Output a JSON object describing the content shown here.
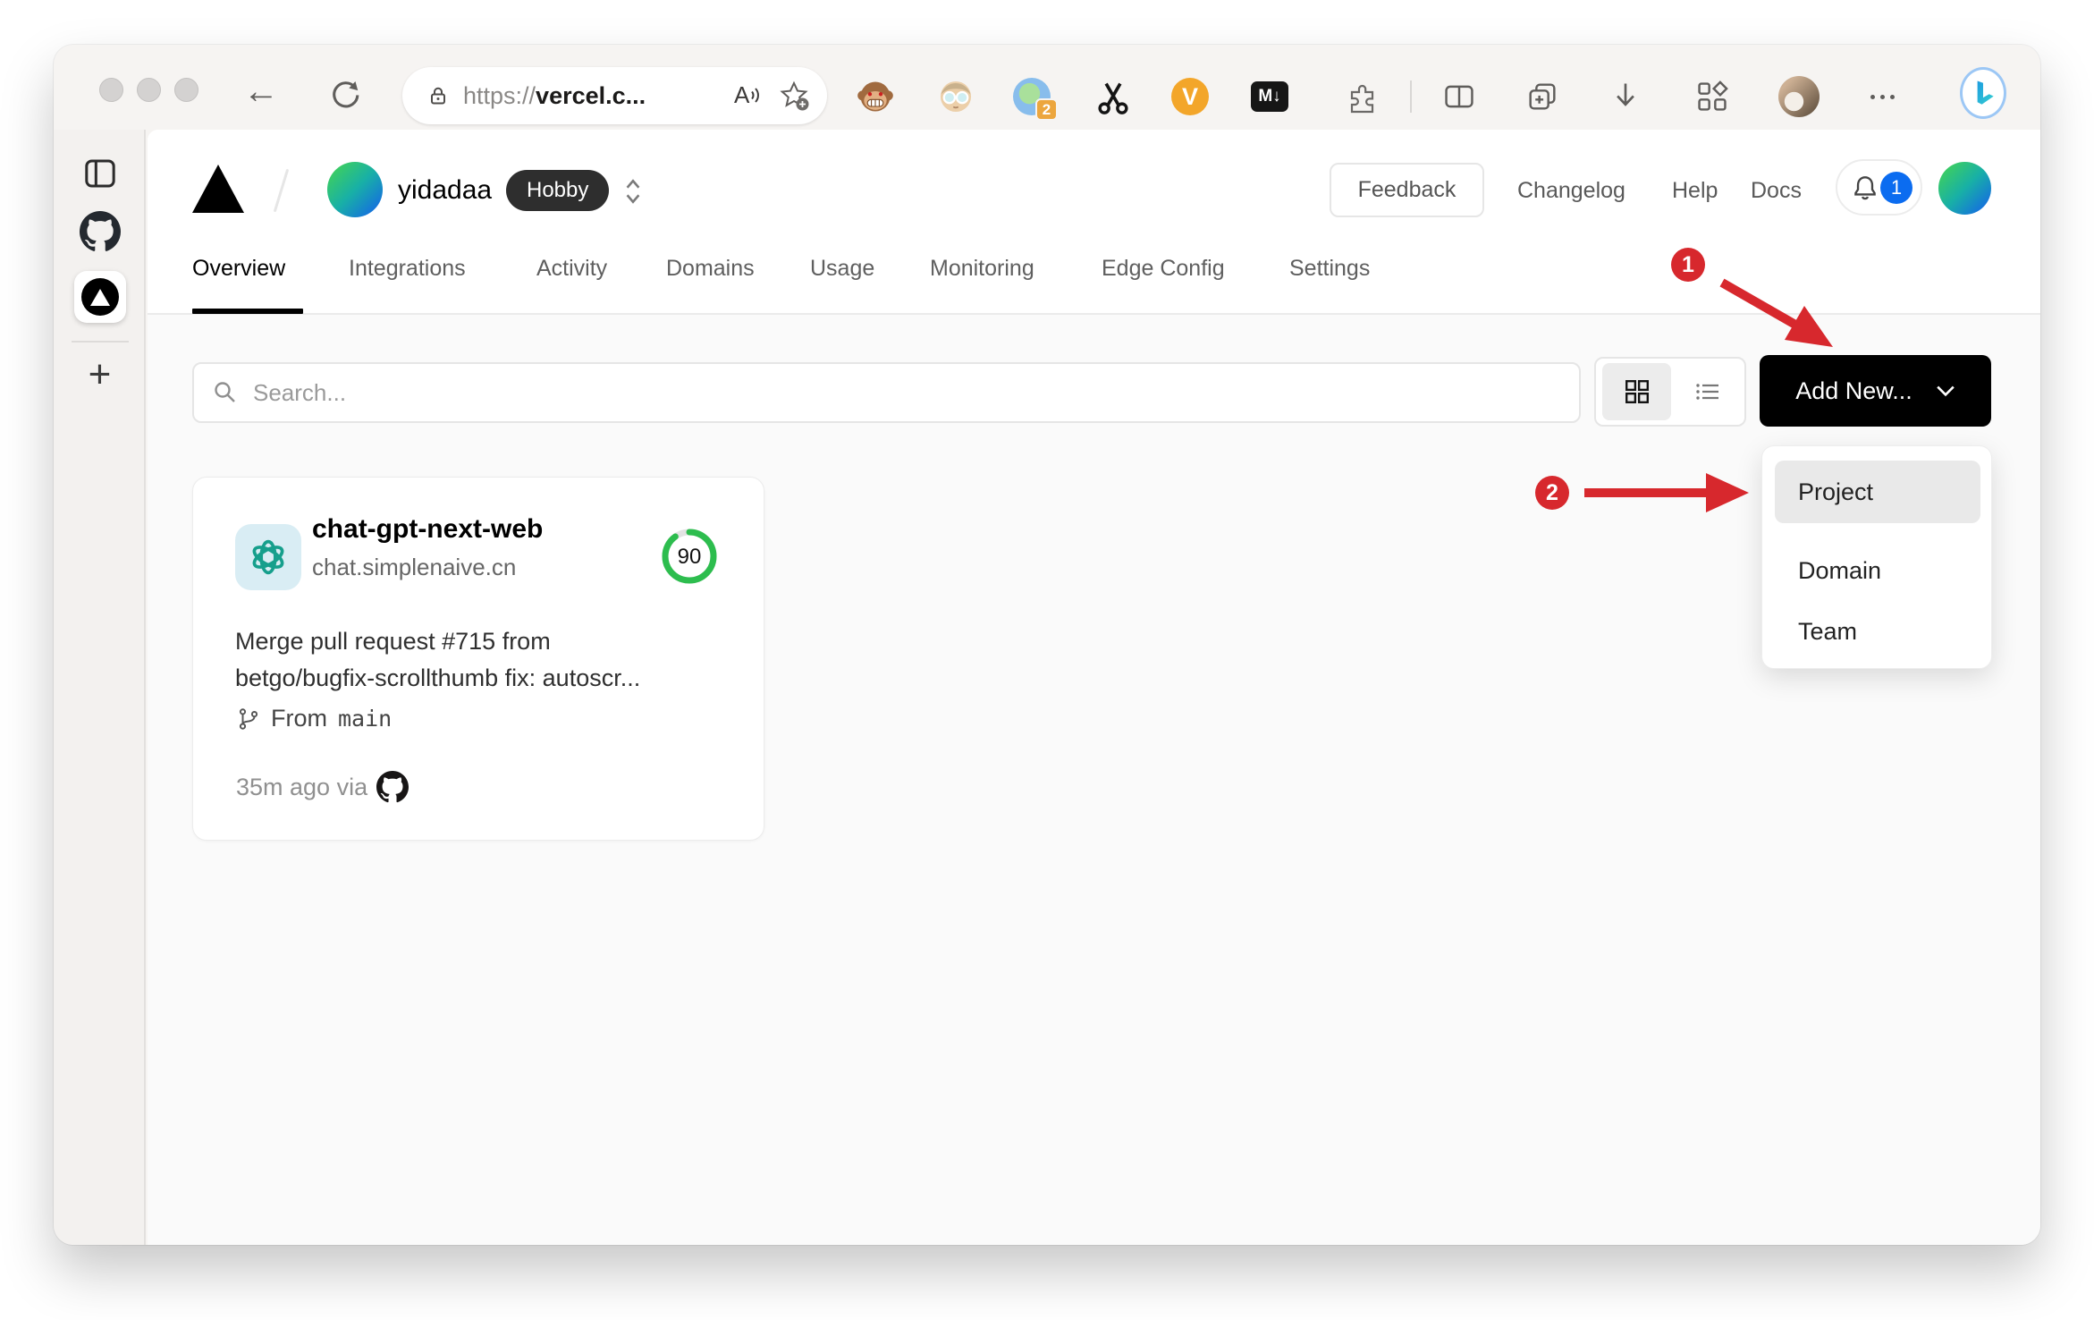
{
  "browser": {
    "url": {
      "scheme": "https://",
      "host": "vercel.c..."
    },
    "extensions": {
      "proxy_badge": "2",
      "markdown_label": "M↓",
      "v_label": "V"
    }
  },
  "vercel": {
    "team": "yidadaa",
    "plan": "Hobby",
    "feedback": "Feedback",
    "links": [
      {
        "label": "Changelog"
      },
      {
        "label": "Help"
      },
      {
        "label": "Docs"
      }
    ],
    "notification_count": "1",
    "tabs": [
      {
        "label": "Overview"
      },
      {
        "label": "Integrations"
      },
      {
        "label": "Activity"
      },
      {
        "label": "Domains"
      },
      {
        "label": "Usage"
      },
      {
        "label": "Monitoring"
      },
      {
        "label": "Edge Config"
      },
      {
        "label": "Settings"
      }
    ],
    "search_placeholder": "Search...",
    "add_new_label": "Add New...",
    "menu_items": [
      {
        "label": "Project"
      },
      {
        "label": "Domain"
      },
      {
        "label": "Team"
      }
    ],
    "project": {
      "name": "chat-gpt-next-web",
      "domain": "chat.simplenaive.cn",
      "score": "90",
      "commit_line1": "Merge pull request #715 from",
      "commit_line2": "betgo/bugfix-scrollthumb fix: autoscr...",
      "branch_prefix": "From",
      "branch_name": "main",
      "deployed_text": "35m ago via"
    }
  },
  "annotations": {
    "step1": "1",
    "step2": "2"
  },
  "colors": {
    "annotation_red": "#D7282D",
    "notification_blue": "#0B6CF0",
    "score_green": "#2DBD4E",
    "avatar_gradient": [
      "#3ECF5E",
      "#1565E8"
    ],
    "add_new_black": "#000000"
  }
}
